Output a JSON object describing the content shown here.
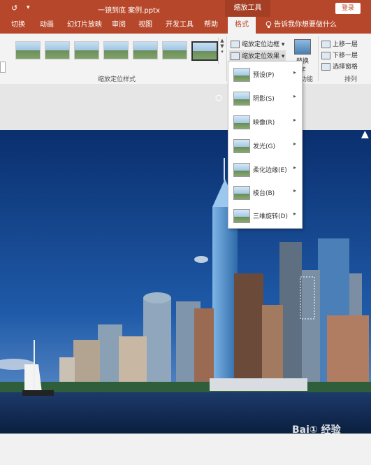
{
  "titlebar": {
    "save_icon": "save-icon",
    "qa_text": "↺",
    "qa_more": "▾",
    "title": "一镜到底 案例.pptx",
    "context_tab": "缩放工具",
    "login": "登录"
  },
  "tabs": {
    "items": [
      "切换",
      "动画",
      "幻灯片放映",
      "审阅",
      "视图",
      "开发工具",
      "帮助"
    ],
    "active": "格式",
    "tellme": "告诉我你想要做什么"
  },
  "ribbon": {
    "styles_group": "缩放定位样式",
    "border_cmd": "缩放定位边框",
    "effect_cmd": "缩放定位效果",
    "replace_a": "替换",
    "replace_b": "字",
    "function_group": "功能",
    "bring_forward": "上移一层",
    "send_backward": "下移一层",
    "selection_pane": "选择窗格",
    "arrange_group": "排列",
    "dropdown_arrow": "▾"
  },
  "menu": {
    "items": [
      {
        "label": "预设(P)",
        "arrow": "▸"
      },
      {
        "label": "阴影(S)",
        "arrow": "▸"
      },
      {
        "label": "映像(R)",
        "arrow": "▸"
      },
      {
        "label": "发光(G)",
        "arrow": "▸"
      },
      {
        "label": "柔化边缘(E)",
        "arrow": "▸"
      },
      {
        "label": "棱台(B)",
        "arrow": "▸"
      },
      {
        "label": "三维旋转(D)",
        "arrow": "▸"
      }
    ]
  },
  "watermark": "Bai① 经验",
  "colors": {
    "accent": "#b7472a",
    "sky": "#0b3f86"
  }
}
